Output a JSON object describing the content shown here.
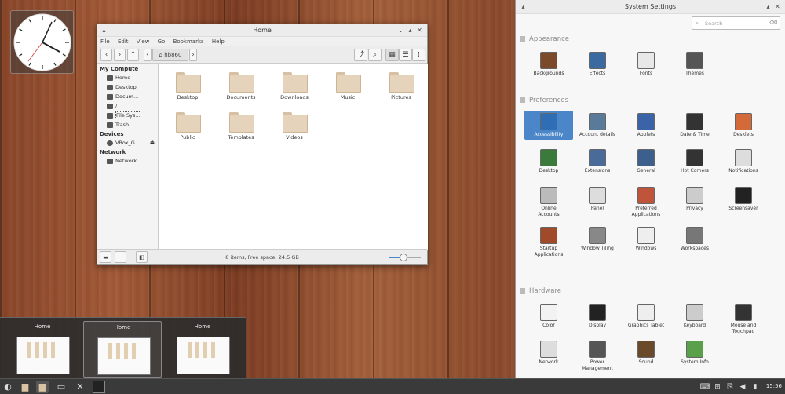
{
  "file_manager": {
    "title": "Home",
    "menu": [
      "File",
      "Edit",
      "View",
      "Go",
      "Bookmarks",
      "Help"
    ],
    "location": "hb860",
    "sidebar": {
      "sections": [
        {
          "title": "My Compute",
          "items": [
            "Home",
            "Desktop",
            "Docum...",
            "/",
            "File Sys...",
            "Trash"
          ]
        },
        {
          "title": "Devices",
          "items": [
            "VBox_G..."
          ]
        },
        {
          "title": "Network",
          "items": [
            "Network"
          ]
        }
      ]
    },
    "folders": [
      "Desktop",
      "Documents",
      "Downloads",
      "Music",
      "Pictures",
      "Public",
      "Templates",
      "Videos"
    ],
    "status": "8 items, Free space: 24.5 GB",
    "zoom_level": 0.45
  },
  "settings": {
    "title": "System Settings",
    "search_placeholder": "Search",
    "sections": [
      {
        "title": "Appearance",
        "items": [
          {
            "label": "Backgrounds",
            "icon": "backgrounds-icon",
            "color": "#7a4a2a"
          },
          {
            "label": "Effects",
            "icon": "effects-icon",
            "color": "#3b6aa0"
          },
          {
            "label": "Fonts",
            "icon": "fonts-icon",
            "color": "#e8e8e8"
          },
          {
            "label": "Themes",
            "icon": "themes-icon",
            "color": "#555555"
          }
        ]
      },
      {
        "title": "Preferences",
        "items": [
          {
            "label": "Accessibility",
            "icon": "accessibility-icon",
            "color": "#2f6db5",
            "selected": true
          },
          {
            "label": "Account details",
            "icon": "account-icon",
            "color": "#5a7a9a"
          },
          {
            "label": "Applets",
            "icon": "applets-icon",
            "color": "#3a63a8"
          },
          {
            "label": "Date & Time",
            "icon": "date-time-icon",
            "color": "#333333"
          },
          {
            "label": "Desklets",
            "icon": "desklets-icon",
            "color": "#d46a3a"
          },
          {
            "label": "Desktop",
            "icon": "desktop-icon",
            "color": "#3a7a3a"
          },
          {
            "label": "Extensions",
            "icon": "extensions-icon",
            "color": "#4a6a9a"
          },
          {
            "label": "General",
            "icon": "general-icon",
            "color": "#3d5f8e"
          },
          {
            "label": "Hot Corners",
            "icon": "hot-corners-icon",
            "color": "#333333"
          },
          {
            "label": "Notifications",
            "icon": "notifications-icon",
            "color": "#dddddd"
          },
          {
            "label": "Online\nAccounts",
            "icon": "online-accounts-icon",
            "color": "#bbbbbb"
          },
          {
            "label": "Panel",
            "icon": "panel-icon",
            "color": "#dddddd"
          },
          {
            "label": "Preferred\nApplications",
            "icon": "preferred-apps-icon",
            "color": "#c0543a"
          },
          {
            "label": "Privacy",
            "icon": "privacy-icon",
            "color": "#cccccc"
          },
          {
            "label": "Screensaver",
            "icon": "screensaver-icon",
            "color": "#222222"
          },
          {
            "label": "Startup\nApplications",
            "icon": "startup-apps-icon",
            "color": "#a04a2a"
          },
          {
            "label": "Window Tiling",
            "icon": "window-tiling-icon",
            "color": "#888888"
          },
          {
            "label": "Windows",
            "icon": "windows-icon",
            "color": "#eeeeee"
          },
          {
            "label": "Workspaces",
            "icon": "workspaces-icon",
            "color": "#777777"
          }
        ]
      },
      {
        "title": "Hardware",
        "items": [
          {
            "label": "Color",
            "icon": "color-icon",
            "color": "#f2f2f2"
          },
          {
            "label": "Display",
            "icon": "display-icon",
            "color": "#222222"
          },
          {
            "label": "Graphics Tablet",
            "icon": "graphics-tablet-icon",
            "color": "#eeeeee"
          },
          {
            "label": "Keyboard",
            "icon": "keyboard-icon",
            "color": "#cccccc"
          },
          {
            "label": "Mouse and\nTouchpad",
            "icon": "mouse-icon",
            "color": "#333333"
          },
          {
            "label": "Network",
            "icon": "network-icon",
            "color": "#dddddd"
          },
          {
            "label": "Power\nManagement",
            "icon": "power-icon",
            "color": "#555555"
          },
          {
            "label": "Sound",
            "icon": "sound-icon",
            "color": "#6a4a2a"
          },
          {
            "label": "System Info",
            "icon": "system-info-icon",
            "color": "#5aa04a"
          }
        ]
      }
    ]
  },
  "workspaces": [
    "Home",
    "Home",
    "Home"
  ],
  "panel": {
    "clock": "15:56"
  }
}
